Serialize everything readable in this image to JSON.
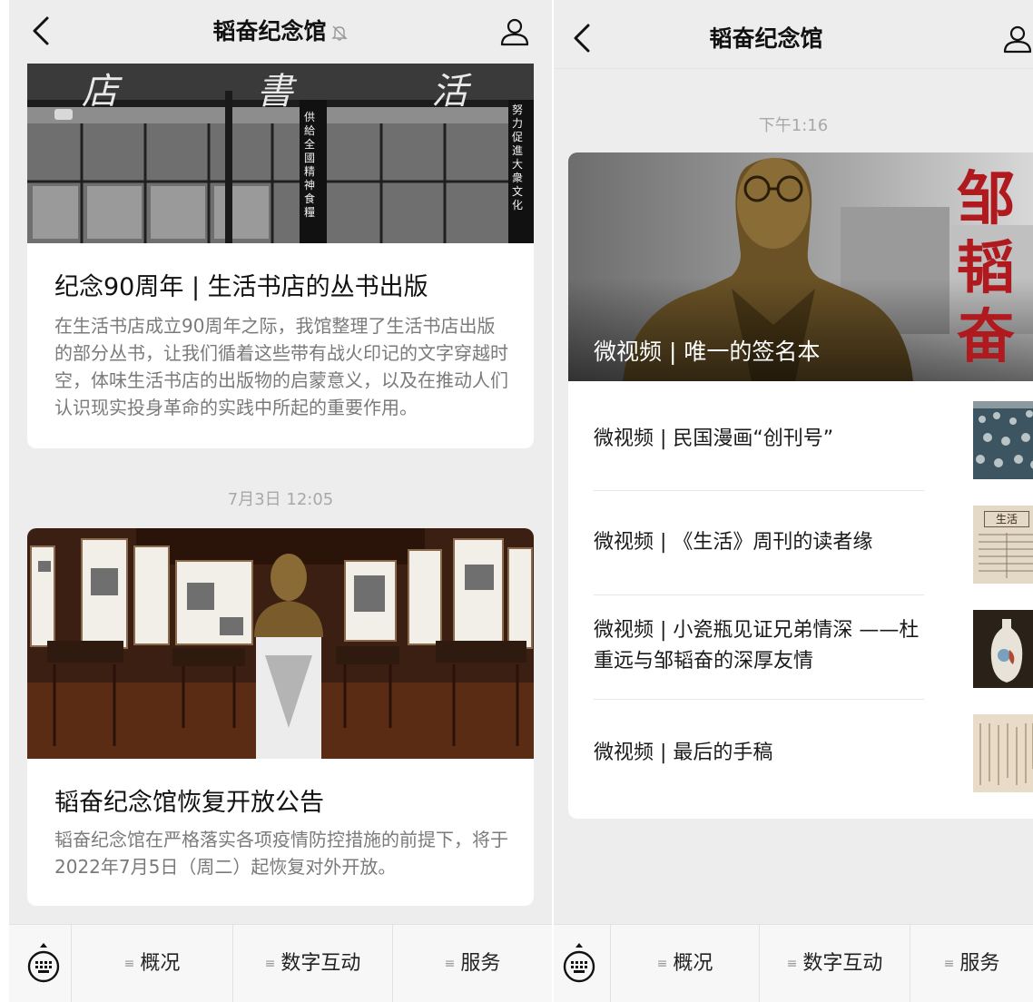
{
  "left": {
    "nav": {
      "title": "韬奋纪念馆"
    },
    "articles": [
      {
        "photo_sign_text": "店 書 活 生",
        "photo_pillar_left": "供給全國精神食糧",
        "photo_pillar_right": "努力促進大衆文化",
        "title": "纪念90周年 | 生活书店的丛书出版",
        "desc": "在生活书店成立90周年之际，我馆整理了生活书店出版的部分丛书，让我们循着这些带有战火印记的文字穿越时空，体味生活书店的出版物的启蒙意义，以及在推动人们认识现实投身革命的实践中所起的重要作用。"
      },
      {
        "timestamp": "7月3日 12:05",
        "title": "韬奋纪念馆恢复开放公告",
        "desc": "韬奋纪念馆在严格落实各项疫情防控措施的前提下，将于2022年7月5日（周二）起恢复对外开放。"
      }
    ],
    "menu": [
      "概况",
      "数字互动",
      "服务"
    ]
  },
  "right": {
    "nav": {
      "title": "韬奋纪念馆"
    },
    "timestamp": "下午1:16",
    "cover": {
      "overlay_title": "微视频 | 唯一的签名本",
      "calligraphy": "邹韬奋"
    },
    "items": [
      {
        "title": "微视频 | 民国漫画“创刊号”"
      },
      {
        "title": "微视频 | 《生活》周刊的读者缘",
        "thumb_text": "生活"
      },
      {
        "title": "微视频 | 小瓷瓶见证兄弟情深 ——杜重远与邹韬奋的深厚友情"
      },
      {
        "title": "微视频 | 最后的手稿"
      }
    ],
    "menu": [
      "概况",
      "数字互动",
      "服务"
    ]
  },
  "icons": {
    "back": "chevron-left-icon",
    "mute": "bell-muted-icon",
    "profile": "person-icon",
    "keyboard": "keyboard-icon",
    "menu": "menu-lines-icon"
  },
  "colors": {
    "background": "#ededed",
    "card": "#ffffff",
    "text_primary": "#111111",
    "text_secondary": "#7a7a7a",
    "timestamp": "#a8a8a8",
    "calligraphy_red": "#b0191e"
  }
}
